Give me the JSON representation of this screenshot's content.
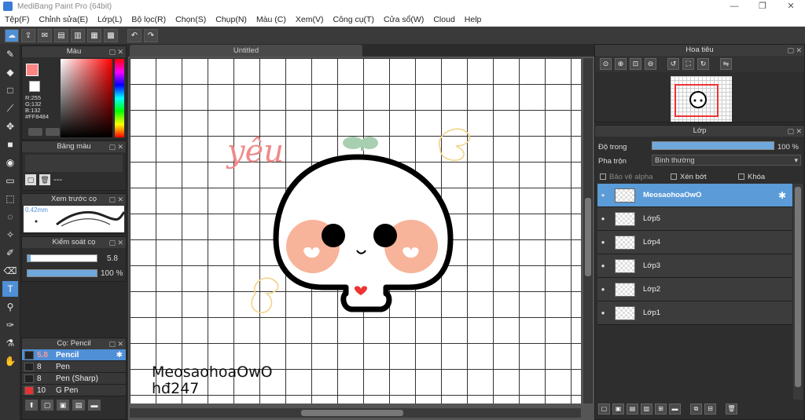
{
  "window": {
    "title": "MediBang Paint Pro (64bit)",
    "controls": [
      "—",
      "❐",
      "✕"
    ]
  },
  "menu": [
    "Tệp(F)",
    "Chỉnh sửa(E)",
    "Lớp(L)",
    "Bộ lọc(R)",
    "Chọn(S)",
    "Chụp(N)",
    "Màu (C)",
    "Xem(V)",
    "Công cụ(T)",
    "Cửa sổ(W)",
    "Cloud",
    "Help"
  ],
  "color_panel": {
    "title": "Màu",
    "r": "R:255",
    "g": "G:132",
    "b": "B:132",
    "hex": "#FF8484",
    "fg_color": "#ff8484"
  },
  "palette_panel": {
    "title": "Bảng màu",
    "empty_label": "---"
  },
  "preview_panel": {
    "title": "Xem trước cọ",
    "size": "0.42mm"
  },
  "control_panel": {
    "title": "Kiểm soát cọ",
    "size_value": "5.8",
    "size_fraction": 0.05,
    "opacity_value": "100 %",
    "opacity_fraction": 1.0
  },
  "brush_panel": {
    "title": "Cọ: Pencil",
    "brushes": [
      {
        "size": "5.8",
        "name": "Pencil",
        "color": "#222222",
        "selected": true
      },
      {
        "size": "8",
        "name": "Pen",
        "color": "#222222",
        "selected": false
      },
      {
        "size": "8",
        "name": "Pen (Sharp)",
        "color": "#222222",
        "selected": false
      },
      {
        "size": "10",
        "name": "G Pen",
        "color": "#e53333",
        "selected": false
      }
    ]
  },
  "canvas": {
    "tab_title": "Untitled",
    "handwriting": "yêu",
    "caption_line1": "MeosaohoaOwO",
    "caption_line2": "hđ247"
  },
  "navigator": {
    "title": "Hoa tiêu"
  },
  "layers_panel": {
    "title": "Lớp",
    "opacity_label": "Độ trong",
    "opacity_value": "100 %",
    "blend_label": "Pha trộn",
    "blend_value": "Bình thường",
    "protect_alpha": "Bảo vệ alpha",
    "clipping": "Xén bớt",
    "lock": "Khóa",
    "layers": [
      {
        "name": "MeosaohoaOwO",
        "selected": true
      },
      {
        "name": "Lớp5",
        "selected": false
      },
      {
        "name": "Lớp4",
        "selected": false
      },
      {
        "name": "Lớp3",
        "selected": false
      },
      {
        "name": "Lớp2",
        "selected": false
      },
      {
        "name": "Lớp1",
        "selected": false
      }
    ]
  },
  "icons": {
    "tools": [
      "brush-icon",
      "eraser-icon",
      "rectangle-icon",
      "pen-icon",
      "move-icon",
      "fill-rect-icon",
      "bucket-icon",
      "gradient-icon",
      "select-rect-icon",
      "lasso-icon",
      "magic-wand-icon",
      "select-pen-icon",
      "select-eraser-icon",
      "text-icon",
      "operation-icon",
      "eyedropper-icon",
      "dropper-icon",
      "hand-icon"
    ]
  },
  "colors": {
    "accent": "#4f8fd6",
    "selected_layer": "#5b9bd8",
    "cheek": "#f7b49a",
    "handwriting": "#f08a8a",
    "leaf": "#a9cfb1",
    "flower": "#f2d48a"
  }
}
